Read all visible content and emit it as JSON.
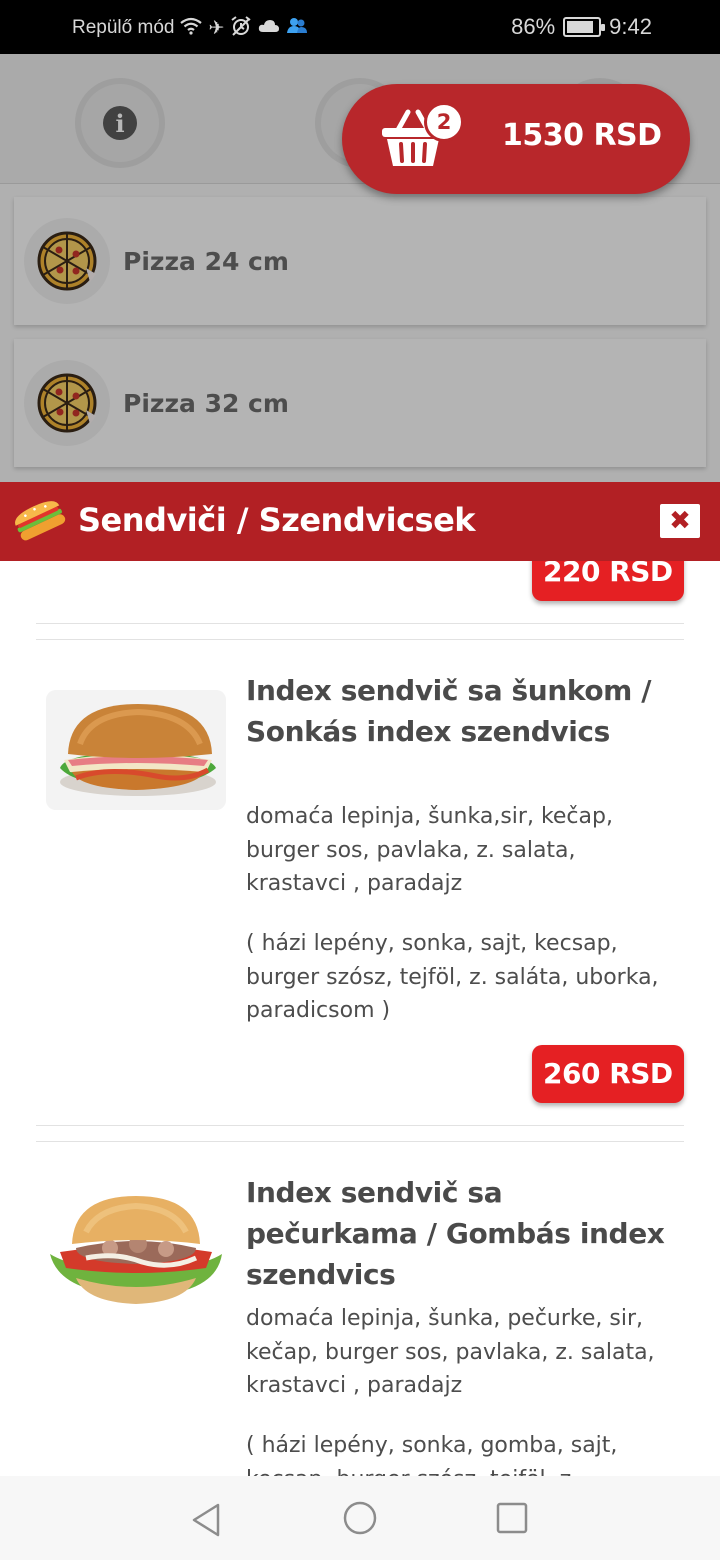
{
  "status_bar": {
    "mode_text": "Repülő mód",
    "battery": "86%",
    "battery_level": 0.86,
    "time": "9:42",
    "icons": [
      "wifi-icon",
      "airplane-icon",
      "alarm-icon",
      "cloud-icon",
      "people-icon"
    ]
  },
  "toolbar": {
    "icons": [
      "info-icon",
      "location-pin-icon",
      "heart-icon"
    ]
  },
  "categories": [
    {
      "label": "Pizza 24 cm",
      "icon": "pizza-icon"
    },
    {
      "label": "Pizza 32 cm",
      "icon": "pizza-icon"
    }
  ],
  "cart": {
    "count": "2",
    "total": "1530 RSD",
    "icon": "basket-icon"
  },
  "modal": {
    "title": "Sendviči / Szendvicsek",
    "icon": "sandwich-icon",
    "close_label": "✖"
  },
  "items": [
    {
      "title": "",
      "price": "220 RSD"
    },
    {
      "title": "Index sendvič sa šunkom / Sonkás index szendvics",
      "desc_sr": "domaća lepinja, šunka,sir, kečap, burger sos, pavlaka, z. salata, krastavci , paradajz",
      "desc_hu": "( házi lepény, sonka, sajt, kecsap, burger szósz, tejföl, z. saláta, uborka, paradicsom )",
      "price": "260 RSD"
    },
    {
      "title": "Index sendvič sa pečurkama / Gombás index szendvics",
      "desc_sr": "domaća lepinja, šunka, pečurke, sir, kečap, burger sos, pavlaka, z. salata, krastavci , paradajz",
      "desc_hu": "( házi lepény, sonka, gomba, sajt, kecsap, burger szósz, tejföl, z."
    }
  ],
  "colors": {
    "header_red": "#b22024",
    "price_red": "#e52023",
    "cart_red": "#b8272b"
  }
}
